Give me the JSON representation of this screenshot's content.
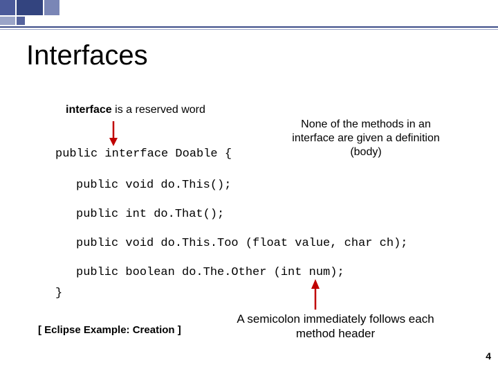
{
  "title": "Interfaces",
  "annotations": {
    "reserved_pre": "interface",
    "reserved_post": " is a reserved word",
    "none_body": "None of the methods in an interface are given a definition (body)",
    "semicolon": "A semicolon immediately follows each method header"
  },
  "code": {
    "l1": "public interface Doable {",
    "l2": "public void do.This();",
    "l3": "public int do.That();",
    "l4": "public void do.This.Too (float value, char ch);",
    "l5": "public boolean do.The.Other (int num);",
    "l6": "}"
  },
  "eclipse_link": "[ Eclipse Example: Creation ]",
  "page_number": "4"
}
